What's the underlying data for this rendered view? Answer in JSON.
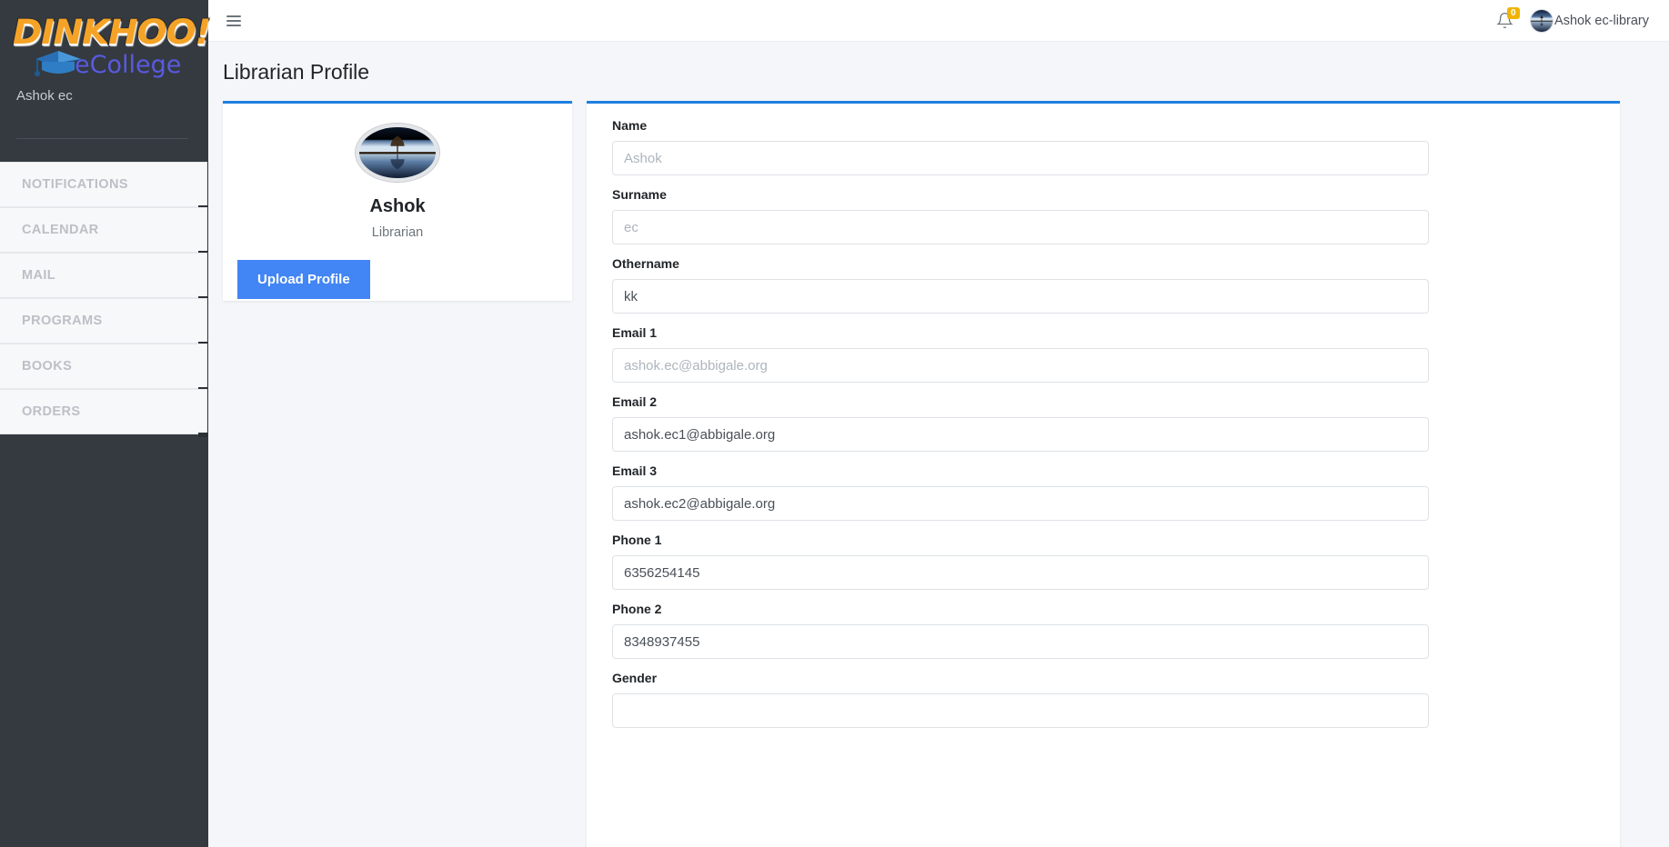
{
  "sidebar": {
    "logo": {
      "primary_text": "DINKHOO!",
      "secondary_text": "eCollege",
      "primary_color": "#f5a327",
      "secondary_color": "#5a5ae0"
    },
    "user_label": "Ashok ec",
    "items": [
      {
        "label": "NOTIFICATIONS"
      },
      {
        "label": "CALENDAR"
      },
      {
        "label": "MAIL"
      },
      {
        "label": "PROGRAMS"
      },
      {
        "label": "BOOKS"
      },
      {
        "label": "ORDERS"
      }
    ]
  },
  "topbar": {
    "notification_count": "0",
    "user_name": "Ashok ec-library"
  },
  "page": {
    "title": "Librarian Profile"
  },
  "profile_card": {
    "name": "Ashok",
    "role": "Librarian",
    "upload_button": "Upload Profile"
  },
  "form": {
    "fields": [
      {
        "label": "Name",
        "value": "",
        "placeholder": "Ashok"
      },
      {
        "label": "Surname",
        "value": "",
        "placeholder": "ec"
      },
      {
        "label": "Othername",
        "value": "kk",
        "placeholder": ""
      },
      {
        "label": "Email 1",
        "value": "",
        "placeholder": "ashok.ec@abbigale.org"
      },
      {
        "label": "Email 2",
        "value": "ashok.ec1@abbigale.org",
        "placeholder": ""
      },
      {
        "label": "Email 3",
        "value": "ashok.ec2@abbigale.org",
        "placeholder": ""
      },
      {
        "label": "Phone 1",
        "value": "6356254145",
        "placeholder": ""
      },
      {
        "label": "Phone 2",
        "value": "8348937455",
        "placeholder": ""
      },
      {
        "label": "Gender",
        "value": "",
        "placeholder": ""
      }
    ]
  },
  "colors": {
    "accent": "#1d7fe0",
    "button": "#4285f4",
    "sidebar_bg": "#343a40",
    "badge": "#f0b400",
    "page_bg": "#f4f6f9"
  }
}
